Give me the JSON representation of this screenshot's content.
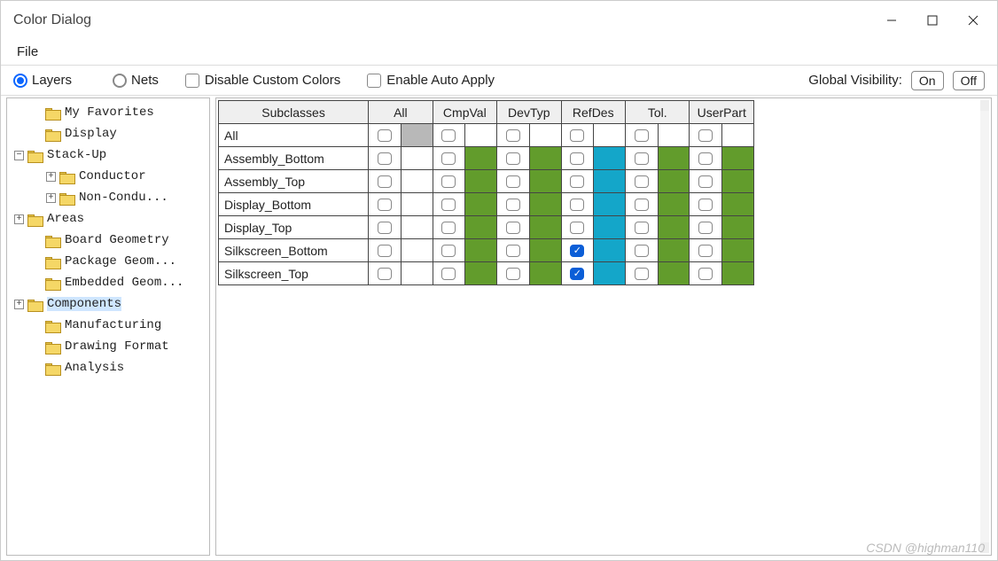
{
  "window": {
    "title": "Color Dialog"
  },
  "menubar": {
    "file": "File"
  },
  "toolbar": {
    "radio_layers": "Layers",
    "radio_nets": "Nets",
    "disable_custom": "Disable Custom Colors",
    "enable_auto": "Enable Auto Apply",
    "global_visibility": "Global Visibility:",
    "btn_on": "On",
    "btn_off": "Off"
  },
  "tree": {
    "items": [
      {
        "label": "My Favorites",
        "indent": 1,
        "expander": "",
        "selected": false
      },
      {
        "label": "Display",
        "indent": 1,
        "expander": "",
        "selected": false
      },
      {
        "label": "Stack-Up",
        "indent": 0,
        "expander": "-",
        "selected": false
      },
      {
        "label": "Conductor",
        "indent": 2,
        "expander": "+",
        "selected": false
      },
      {
        "label": "Non-Condu...",
        "indent": 2,
        "expander": "+",
        "selected": false
      },
      {
        "label": "Areas",
        "indent": 0,
        "expander": "+",
        "selected": false
      },
      {
        "label": "Board Geometry",
        "indent": 1,
        "expander": "",
        "selected": false
      },
      {
        "label": "Package Geom...",
        "indent": 1,
        "expander": "",
        "selected": false
      },
      {
        "label": "Embedded Geom...",
        "indent": 1,
        "expander": "",
        "selected": false
      },
      {
        "label": "Components",
        "indent": 0,
        "expander": "+",
        "selected": true
      },
      {
        "label": "Manufacturing",
        "indent": 1,
        "expander": "",
        "selected": false
      },
      {
        "label": "Drawing Format",
        "indent": 1,
        "expander": "",
        "selected": false
      },
      {
        "label": "Analysis",
        "indent": 1,
        "expander": "",
        "selected": false
      }
    ]
  },
  "grid": {
    "headers": {
      "subclasses": "Subclasses",
      "cols": [
        "All",
        "CmpVal",
        "DevTyp",
        "RefDes",
        "Tol.",
        "UserPart"
      ]
    },
    "rows": [
      {
        "label": "All",
        "cells": [
          {
            "check": false,
            "color": "gray"
          },
          {
            "check": false,
            "color": ""
          },
          {
            "check": false,
            "color": ""
          },
          {
            "check": false,
            "color": ""
          },
          {
            "check": false,
            "color": ""
          },
          {
            "check": false,
            "color": ""
          }
        ]
      },
      {
        "label": "Assembly_Bottom",
        "cells": [
          {
            "check": false,
            "color": ""
          },
          {
            "check": false,
            "color": "green"
          },
          {
            "check": false,
            "color": "green"
          },
          {
            "check": false,
            "color": "teal"
          },
          {
            "check": false,
            "color": "green"
          },
          {
            "check": false,
            "color": "green"
          }
        ]
      },
      {
        "label": "Assembly_Top",
        "cells": [
          {
            "check": false,
            "color": ""
          },
          {
            "check": false,
            "color": "green"
          },
          {
            "check": false,
            "color": "green"
          },
          {
            "check": false,
            "color": "teal"
          },
          {
            "check": false,
            "color": "green"
          },
          {
            "check": false,
            "color": "green"
          }
        ]
      },
      {
        "label": "Display_Bottom",
        "cells": [
          {
            "check": false,
            "color": ""
          },
          {
            "check": false,
            "color": "green"
          },
          {
            "check": false,
            "color": "green"
          },
          {
            "check": false,
            "color": "teal"
          },
          {
            "check": false,
            "color": "green"
          },
          {
            "check": false,
            "color": "green"
          }
        ]
      },
      {
        "label": "Display_Top",
        "cells": [
          {
            "check": false,
            "color": ""
          },
          {
            "check": false,
            "color": "green"
          },
          {
            "check": false,
            "color": "green"
          },
          {
            "check": false,
            "color": "teal"
          },
          {
            "check": false,
            "color": "green"
          },
          {
            "check": false,
            "color": "green"
          }
        ]
      },
      {
        "label": "Silkscreen_Bottom",
        "cells": [
          {
            "check": false,
            "color": ""
          },
          {
            "check": false,
            "color": "green"
          },
          {
            "check": false,
            "color": "green"
          },
          {
            "check": true,
            "color": "teal"
          },
          {
            "check": false,
            "color": "green"
          },
          {
            "check": false,
            "color": "green"
          }
        ]
      },
      {
        "label": "Silkscreen_Top",
        "cells": [
          {
            "check": false,
            "color": ""
          },
          {
            "check": false,
            "color": "green"
          },
          {
            "check": false,
            "color": "green"
          },
          {
            "check": true,
            "color": "teal"
          },
          {
            "check": false,
            "color": "green"
          },
          {
            "check": false,
            "color": "green"
          }
        ]
      }
    ]
  },
  "watermark": "CSDN @highman110"
}
